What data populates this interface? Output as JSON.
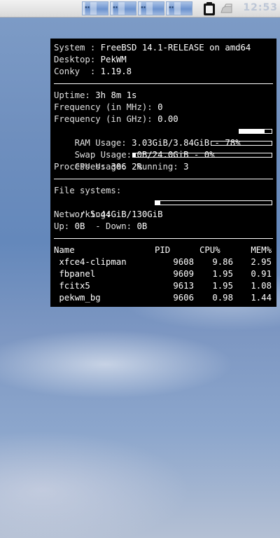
{
  "panel": {
    "taskbar_items": [
      {
        "name": "workspace-1"
      },
      {
        "name": "workspace-2"
      },
      {
        "name": "workspace-3"
      },
      {
        "name": "workspace-4"
      }
    ],
    "clock": "12:53",
    "clip_icon": "clipboard-icon",
    "iron_icon": "iron-icon"
  },
  "conky": {
    "system_label": "System : ",
    "system_value": "FreeBSD 14.1-RELEASE on amd64",
    "desktop_label": "Desktop: ",
    "desktop_value": "PekWM",
    "conky_label": "Conky  : ",
    "conky_value": "1.19.8",
    "uptime_label": "Uptime: ",
    "uptime_value": "3h 8m 1s",
    "freq_mhz_label": "Frequency (in MHz): ",
    "freq_mhz_value": "0",
    "freq_ghz_label": "Frequency (in GHz): ",
    "freq_ghz_value": "0.00",
    "ram_label": "RAM Usage: ",
    "ram_value": "3.03GiB/3.84GiB - 78%",
    "ram_percent": 78,
    "swap_label": "Swap Usage: ",
    "swap_value": "0B/24.0GiB - 0%",
    "swap_percent": 0,
    "cpu_label": "CPU Usage: ",
    "cpu_value": "2%",
    "cpu_percent": 2,
    "processes_label": "Processes: ",
    "processes_value": "306",
    "running_label": "  Running: ",
    "running_value": "3",
    "fs_label": "File systems:",
    "fs_root_label": " / ",
    "fs_root_value": "5.44GiB/130GiB",
    "fs_percent": 4,
    "net_label": "Networking:",
    "up_label": "Up: ",
    "up_value": "0B",
    "down_label": "  - Down: ",
    "down_value": "0B",
    "proc_headers": {
      "name": "Name",
      "pid": "PID",
      "cpu": "CPU%",
      "mem": "MEM%"
    },
    "processes": [
      {
        "name": " xfce4-clipman",
        "pid": "9608",
        "cpu": "9.86",
        "mem": "2.95"
      },
      {
        "name": " fbpanel",
        "pid": "9609",
        "cpu": "1.95",
        "mem": "0.91"
      },
      {
        "name": " fcitx5",
        "pid": "9613",
        "cpu": "1.95",
        "mem": "1.08"
      },
      {
        "name": " pekwm_bg",
        "pid": "9606",
        "cpu": "0.98",
        "mem": "1.44"
      }
    ]
  }
}
